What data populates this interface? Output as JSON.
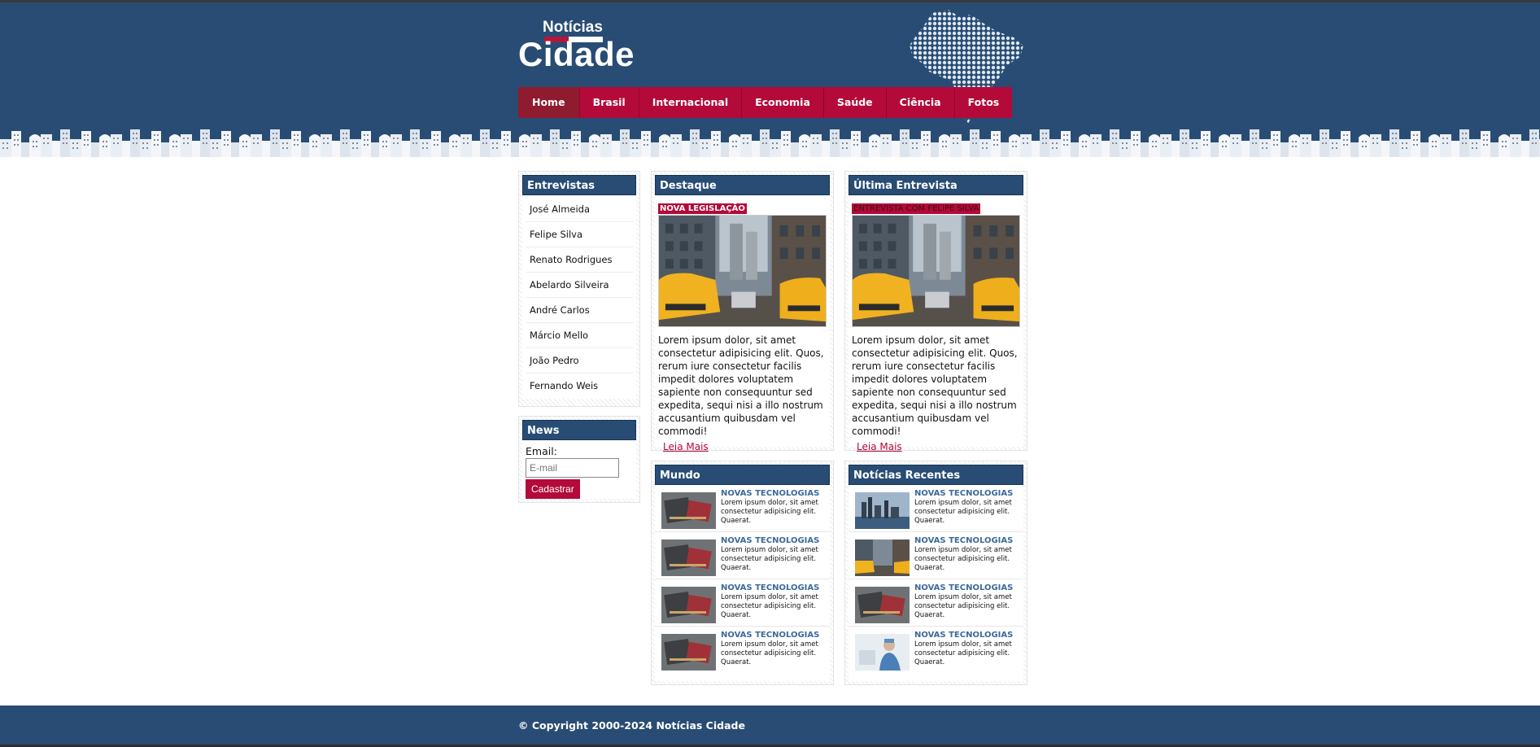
{
  "brand": {
    "top": "Notícias",
    "main": "Cidade"
  },
  "nav": {
    "items": [
      {
        "label": "Home",
        "active": true
      },
      {
        "label": "Brasil"
      },
      {
        "label": "Internacional"
      },
      {
        "label": "Economia"
      },
      {
        "label": "Saúde"
      },
      {
        "label": "Ciência"
      },
      {
        "label": "Fotos"
      }
    ]
  },
  "interviews": {
    "title": "Entrevistas",
    "items": [
      "José Almeida",
      "Felipe Silva",
      "Renato Rodrigues",
      "Abelardo Silveira",
      "André Carlos",
      "Márcio Mello",
      "João Pedro",
      "Fernando Weis"
    ]
  },
  "newsletter": {
    "title": "News",
    "email_label": "Email:",
    "email_placeholder": "E-mail",
    "submit_label": "Cadastrar"
  },
  "highlight": {
    "title": "Destaque",
    "tag": "NOVA LEGISLAÇÃO",
    "text": "Lorem ipsum dolor, sit amet consectetur adipisicing elit. Quos, rerum iure consectetur facilis impedit dolores voluptatem sapiente non consequuntur sed expedita, sequi nisi a illo nostrum accusantium quibusdam vel commodi!",
    "read_more": "Leia Mais"
  },
  "last_interview": {
    "title": "Última Entrevista",
    "tag": "ENTREVISTA COM FELIPE SILVA",
    "text": "Lorem ipsum dolor, sit amet consectetur adipisicing elit. Quos, rerum iure consectetur facilis impedit dolores voluptatem sapiente non consequuntur sed expedita, sequi nisi a illo nostrum accusantium quibusdam vel commodi!",
    "read_more": "Leia Mais"
  },
  "world": {
    "title": "Mundo",
    "items": [
      {
        "title": "NOVAS TECNOLOGIAS",
        "desc": "Lorem ipsum dolor, sit amet consectetur adipisicing elit. Quaerat.",
        "thumb": "desk-photo"
      },
      {
        "title": "NOVAS TECNOLOGIAS",
        "desc": "Lorem ipsum dolor, sit amet consectetur adipisicing elit. Quaerat.",
        "thumb": "desk-photo"
      },
      {
        "title": "NOVAS TECNOLOGIAS",
        "desc": "Lorem ipsum dolor, sit amet consectetur adipisicing elit. Quaerat.",
        "thumb": "desk-photo"
      },
      {
        "title": "NOVAS TECNOLOGIAS",
        "desc": "Lorem ipsum dolor, sit amet consectetur adipisicing elit. Quaerat.",
        "thumb": "desk-photo"
      }
    ]
  },
  "recent": {
    "title": "Notícias Recentes",
    "items": [
      {
        "title": "NOVAS TECNOLOGIAS",
        "desc": "Lorem ipsum dolor, sit amet consectetur adipisicing elit. Quaerat.",
        "thumb": "skyline-photo"
      },
      {
        "title": "NOVAS TECNOLOGIAS",
        "desc": "Lorem ipsum dolor, sit amet consectetur adipisicing elit. Quaerat.",
        "thumb": "taxi-photo"
      },
      {
        "title": "NOVAS TECNOLOGIAS",
        "desc": "Lorem ipsum dolor, sit amet consectetur adipisicing elit. Quaerat.",
        "thumb": "desk-photo"
      },
      {
        "title": "NOVAS TECNOLOGIAS",
        "desc": "Lorem ipsum dolor, sit amet consectetur adipisicing elit. Quaerat.",
        "thumb": "doctor-photo"
      }
    ]
  },
  "footer": {
    "text": "© Copyright 2000-2024 Notícias Cidade"
  },
  "colors": {
    "primary": "#284c74",
    "accent": "#b30a3a",
    "nav_active": "#8e1b2e",
    "link_blue": "#3d6a98"
  }
}
